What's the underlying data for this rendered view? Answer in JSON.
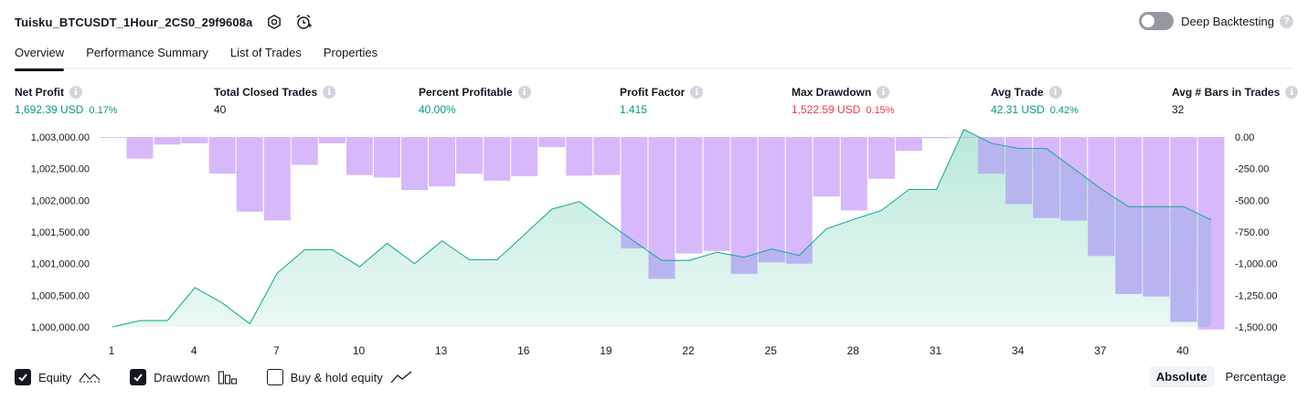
{
  "header": {
    "strategy_title": "Tuisku_BTCUSDT_1Hour_2CS0_29f9608a",
    "settings_icon": "gear-icon",
    "alert_icon": "alarm-clock-plus-icon"
  },
  "deep_backtesting": {
    "label": "Deep Backtesting",
    "enabled": false,
    "help": "?"
  },
  "tabs": [
    {
      "label": "Overview",
      "active": true
    },
    {
      "label": "Performance Summary",
      "active": false
    },
    {
      "label": "List of Trades",
      "active": false
    },
    {
      "label": "Properties",
      "active": false
    }
  ],
  "metrics": {
    "info_glyph": "i",
    "net_profit": {
      "label": "Net Profit",
      "value": "1,692.39 USD",
      "pct": "0.17%"
    },
    "total_closed_trades": {
      "label": "Total Closed Trades",
      "value": "40"
    },
    "percent_profitable": {
      "label": "Percent Profitable",
      "value": "40.00%"
    },
    "profit_factor": {
      "label": "Profit Factor",
      "value": "1.415"
    },
    "max_drawdown": {
      "label": "Max Drawdown",
      "value": "1,522.59 USD",
      "pct": "0.15%"
    },
    "avg_trade": {
      "label": "Avg Trade",
      "value": "42.31 USD",
      "pct": "0.42%"
    },
    "avg_bars": {
      "label": "Avg # Bars in Trades",
      "value": "32"
    }
  },
  "colors": {
    "positive": "#089981",
    "negative": "#f23645",
    "equity_line": "#22ab94",
    "equity_fill": "#d6f2ea",
    "drawdown_fill": "#d7b8fb",
    "overlap_fill": "#b8b4f0"
  },
  "chart_data": {
    "type": "area",
    "x_ticks": [
      "1",
      "4",
      "7",
      "10",
      "13",
      "16",
      "19",
      "22",
      "25",
      "28",
      "31",
      "34",
      "37",
      "40"
    ],
    "left_axis": {
      "ticks": [
        "1,000,000.00",
        "1,000,500.00",
        "1,001,000.00",
        "1,001,500.00",
        "1,002,000.00",
        "1,002,500.00",
        "1,003,000.00"
      ],
      "ylim": [
        1000000,
        1003000
      ]
    },
    "right_axis": {
      "ticks": [
        "0.00",
        "-250.00",
        "-500.00",
        "-750.00",
        "-1,000.00",
        "-1,250.00",
        "-1,500.00"
      ],
      "ylim": [
        -1500,
        0
      ]
    },
    "series": [
      {
        "name": "Equity",
        "x": [
          1,
          2,
          3,
          4,
          5,
          6,
          7,
          8,
          9,
          10,
          11,
          12,
          13,
          14,
          15,
          16,
          17,
          18,
          19,
          20,
          21,
          22,
          23,
          24,
          25,
          26,
          27,
          28,
          29,
          30,
          31,
          32,
          33,
          34,
          35,
          36,
          37,
          38,
          39,
          40,
          41
        ],
        "values": [
          1000000,
          1000100,
          1000100,
          1000620,
          1000380,
          1000050,
          1000850,
          1001220,
          1001220,
          1000950,
          1001320,
          1001000,
          1001360,
          1001060,
          1001060,
          1001460,
          1001860,
          1001980,
          1001660,
          1001350,
          1001050,
          1001050,
          1001180,
          1001100,
          1001230,
          1001130,
          1001550,
          1001700,
          1001840,
          1002170,
          1002170,
          1003120,
          1002900,
          1002820,
          1002820,
          1002500,
          1002180,
          1001900,
          1001900,
          1001900,
          1001690
        ]
      },
      {
        "name": "Drawdown",
        "x": [
          1,
          2,
          3,
          4,
          5,
          6,
          7,
          8,
          9,
          10,
          11,
          12,
          13,
          14,
          15,
          16,
          17,
          18,
          19,
          20,
          21,
          22,
          23,
          24,
          25,
          26,
          27,
          28,
          29,
          30,
          31,
          32,
          33,
          34,
          35,
          36,
          37,
          38,
          39,
          40,
          41
        ],
        "values": [
          0,
          -170,
          -60,
          -50,
          -290,
          -590,
          -660,
          -220,
          -50,
          -300,
          -320,
          -420,
          -390,
          -290,
          -345,
          -310,
          -80,
          -305,
          -300,
          -880,
          -1120,
          -920,
          -900,
          -1080,
          -990,
          -1000,
          -470,
          -580,
          -330,
          -110,
          -10,
          0,
          -290,
          -530,
          -640,
          -660,
          -940,
          -1240,
          -1260,
          -1460,
          -1520
        ]
      }
    ]
  },
  "legend": {
    "equity": {
      "label": "Equity",
      "checked": true
    },
    "drawdown": {
      "label": "Drawdown",
      "checked": true
    },
    "buy_hold": {
      "label": "Buy & hold equity",
      "checked": false
    }
  },
  "modes": [
    {
      "label": "Absolute",
      "active": true
    },
    {
      "label": "Percentage",
      "active": false
    }
  ]
}
